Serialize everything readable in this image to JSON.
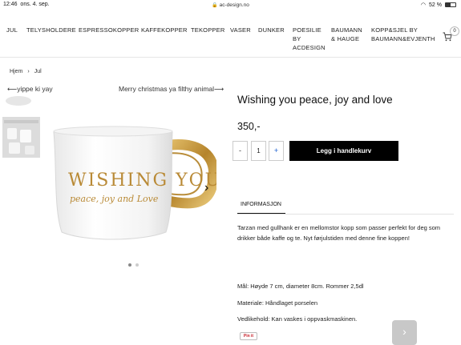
{
  "statusbar": {
    "time": "12:46",
    "date": "ons. 4. sep.",
    "url": "ac-design.no",
    "battery": "52 %",
    "battery_level": 0.52
  },
  "nav": {
    "items": [
      {
        "label": "JUL"
      },
      {
        "label": "TELYSHOLDERE"
      },
      {
        "label": "ESPRESSOKOPPER"
      },
      {
        "label": "KAFFEKOPPER"
      },
      {
        "label": "TEKOPPER"
      },
      {
        "label": "VASER"
      },
      {
        "label": "DUNKER"
      },
      {
        "label": "POESILIE BY ACDESIGN",
        "lines": [
          "POESILIE",
          "BY",
          "ACDESIGN"
        ]
      },
      {
        "label": "BAUMANN & HAUGE",
        "lines": [
          "BAUMANN",
          "& HAUGE"
        ]
      },
      {
        "label": "KOPP&SJEL BY BAUMANN&EVJENTH",
        "lines": [
          "KOPP&SJEL BY",
          "BAUMANN&EVJENTH"
        ]
      }
    ],
    "cart_count": "0"
  },
  "breadcrumb": {
    "home": "Hjem",
    "separator": "›",
    "current": "Jul"
  },
  "pager": {
    "prev": "yippe ki yay",
    "next": "Merry christmas ya filthy animal"
  },
  "product": {
    "title": "Wishing you peace, joy and love",
    "price": "350,-",
    "quantity": "1",
    "minus": "-",
    "plus": "+",
    "add_to_cart": "Legg i handlekurv",
    "tab_label": "INFORMASJON",
    "description": "Tarzan med gullhank er en mellomstor kopp som passer perfekt for deg som drikker både kaffe og te. Nyt førjulstiden med denne fine koppen!",
    "specs": [
      "Mål: Høyde 7 cm, diameter 8cm. Rommer 2,5dl",
      "Materiale: Håndlaget porselen",
      "Vedlikehold: Kan vaskes i oppvaskmaskinen."
    ],
    "pin_label": "Pin it"
  },
  "image": {
    "mug_text_line1": "WISHING YOU",
    "mug_text_line2": "peace, joy and Love",
    "slide_count": 2,
    "active_slide": 0
  },
  "colors": {
    "button_bg": "#000000",
    "gold": "#c79a3c",
    "scroll_button": "#c8c8c8"
  }
}
